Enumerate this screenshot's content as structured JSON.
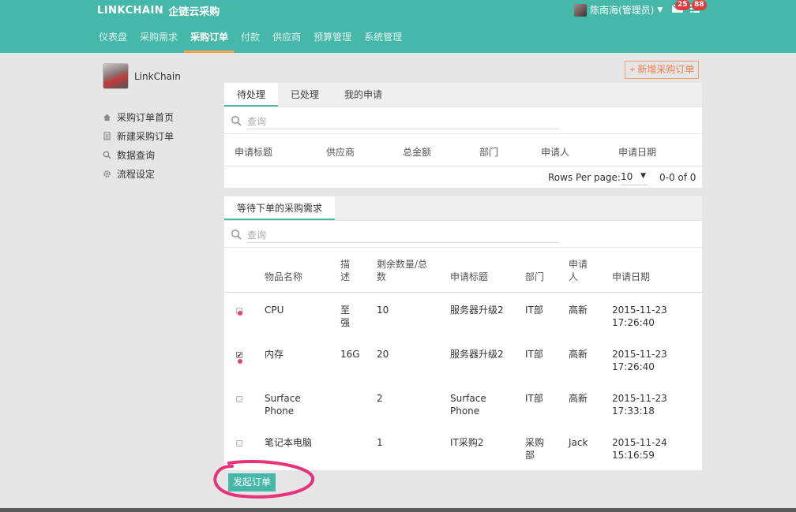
{
  "header": {
    "brand_logo": "LINKCHAIN",
    "brand_name": "企链云采购",
    "user_name": "陈南海(管理员)",
    "mail_count": "25",
    "task_count": "88",
    "nav": [
      {
        "label": "仪表盘"
      },
      {
        "label": "采购需求"
      },
      {
        "label": "采购订单"
      },
      {
        "label": "付款"
      },
      {
        "label": "供应商"
      },
      {
        "label": "预算管理"
      },
      {
        "label": "系统管理"
      }
    ],
    "active_nav": "采购订单",
    "accent": "#46b8aa",
    "active_underline": "#f0a24c"
  },
  "sidebar": {
    "company": "LinkChain",
    "items": [
      {
        "label": "采购订单首页",
        "icon": "home-icon"
      },
      {
        "label": "新建采购订单",
        "icon": "document-icon"
      },
      {
        "label": "数据查询",
        "icon": "search-icon"
      },
      {
        "label": "流程设定",
        "icon": "gear-icon"
      }
    ]
  },
  "actions": {
    "new_order": "+ 新增采购订单",
    "submit_order": "发起订单"
  },
  "orders_panel": {
    "tabs": [
      {
        "label": "待处理"
      },
      {
        "label": "已处理"
      },
      {
        "label": "我的申请"
      }
    ],
    "search_placeholder": "查询",
    "columns": [
      "申请标题",
      "供应商",
      "总金额",
      "部门",
      "申请人",
      "申请日期"
    ],
    "rows_per_page_label": "Rows Per page:",
    "rows_per_page": "10",
    "range": "0-0 of 0"
  },
  "requests_panel": {
    "tab": "等待下单的采购需求",
    "search_placeholder": "查询",
    "columns": {
      "item": "物品名称",
      "desc": "描述",
      "qty": "剩余数量/总数",
      "title": "申请标题",
      "dept": "部门",
      "applicant": "申请人",
      "date": "申请日期"
    },
    "rows": [
      {
        "checked": false,
        "item": "CPU",
        "desc": "至强",
        "qty": "10",
        "title": "服务器升级2",
        "dept": "IT部",
        "applicant": "高新",
        "date": "2015-11-23 17:26:40"
      },
      {
        "checked": true,
        "item": "内存",
        "desc": "16G",
        "qty": "20",
        "title": "服务器升级2",
        "dept": "IT部",
        "applicant": "高新",
        "date": "2015-11-23 17:26:40"
      },
      {
        "checked": false,
        "item": "Surface Phone",
        "desc": "",
        "qty": "2",
        "title": "Surface Phone",
        "dept": "IT部",
        "applicant": "高新",
        "date": "2015-11-23 17:33:18"
      },
      {
        "checked": false,
        "item": "笔记本电脑",
        "desc": "",
        "qty": "1",
        "title": "IT采购2",
        "dept": "采购部",
        "applicant": "Jack",
        "date": "2015-11-24 15:16:59"
      }
    ]
  }
}
